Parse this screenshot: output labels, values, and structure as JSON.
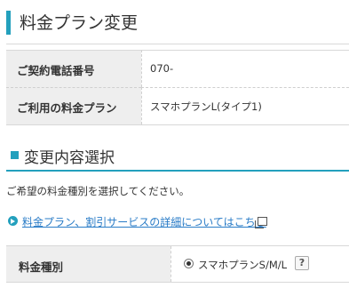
{
  "page": {
    "title": "料金プラン変更"
  },
  "info_table": {
    "rows": [
      {
        "label": "ご契約電話番号",
        "value": "070-"
      },
      {
        "label": "ご利用の料金プラン",
        "value": "スマホプランL(タイプ1)"
      }
    ]
  },
  "section": {
    "title": "変更内容選択",
    "instruction": "ご希望の料金種別を選択してください。",
    "detail_link": "料金プラン、割引サービスの詳細についてはこちら"
  },
  "kind_row": {
    "label": "料金種別",
    "option_label": "スマホプランS/M/L",
    "option_selected": true,
    "help_text": "?"
  },
  "colors": {
    "accent": "#23a0bd",
    "link": "#2a7cc7",
    "header_bg": "#eeeeee"
  }
}
